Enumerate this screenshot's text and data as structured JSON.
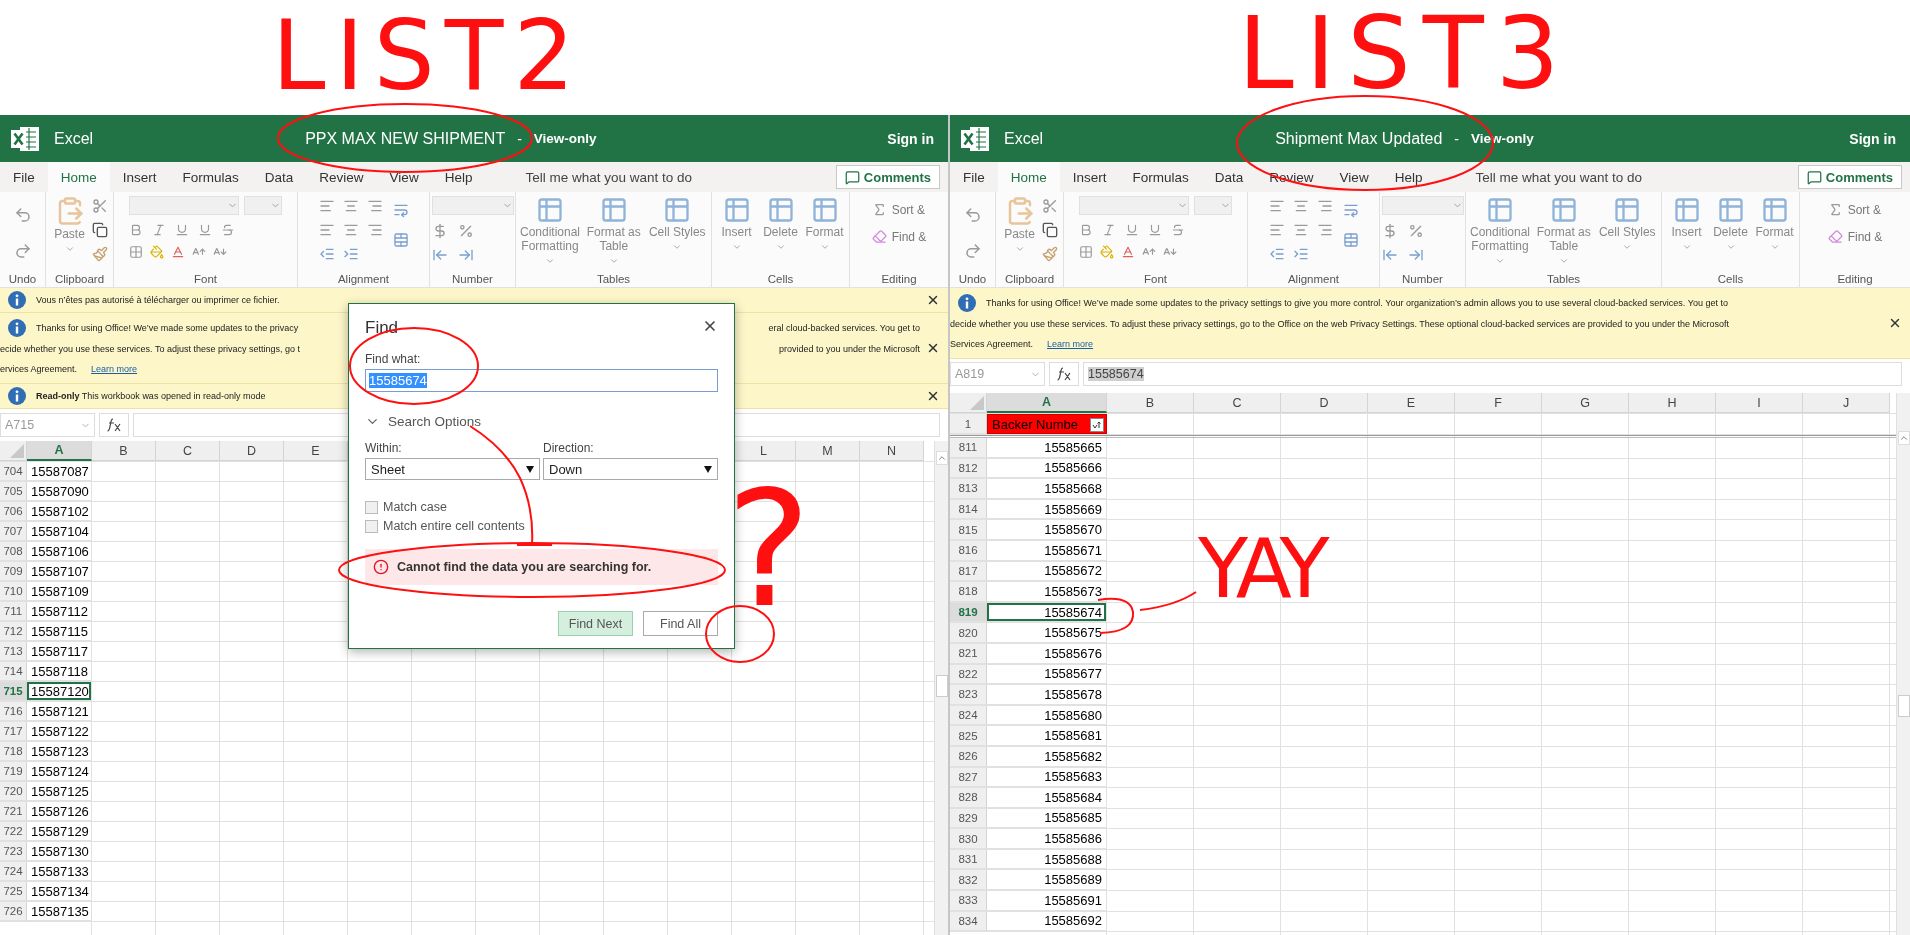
{
  "annotations": {
    "handwriting": [
      {
        "text": "LIST2"
      },
      {
        "text": "LIST3"
      },
      {
        "text": "?"
      },
      {
        "text": "YAY"
      }
    ]
  },
  "panes": [
    {
      "app": "Excel",
      "title": "PPX MAX NEW SHIPMENT",
      "separator": "-",
      "mode": "View-only",
      "sign_in": "Sign in",
      "tabs": [
        {
          "label": "File",
          "selected": false
        },
        {
          "label": "Home",
          "selected": true
        },
        {
          "label": "Insert",
          "selected": false
        },
        {
          "label": "Formulas",
          "selected": false
        },
        {
          "label": "Data",
          "selected": false
        },
        {
          "label": "Review",
          "selected": false
        },
        {
          "label": "View",
          "selected": false
        },
        {
          "label": "Help",
          "selected": false
        }
      ],
      "tell_me": "Tell me what you want to do",
      "comments": "Comments",
      "ribbon": [
        {
          "kind": "undo",
          "label": "Undo"
        },
        {
          "kind": "clipboard",
          "label": "Clipboard",
          "buttons": [
            "Paste"
          ]
        },
        {
          "kind": "font",
          "label": "Font"
        },
        {
          "kind": "alignment",
          "label": "Alignment"
        },
        {
          "kind": "number",
          "label": "Number"
        },
        {
          "kind": "large",
          "label": "Tables",
          "buttons": [
            "Conditional Formatting",
            "Format as Table",
            "Cell Styles"
          ]
        },
        {
          "kind": "large",
          "label": "Cells",
          "buttons": [
            "Insert",
            "Delete",
            "Format"
          ]
        },
        {
          "kind": "editing",
          "label": "Editing",
          "buttons": [
            "Sort &",
            "Find &"
          ]
        }
      ],
      "notifications": [
        {
          "lines": [
            {
              "left": "Vous n’êtes pas autorisé à télécharger ou imprimer ce fichier."
            }
          ]
        },
        {
          "lines": [
            {
              "left": "Thanks for using Office! We’ve made some updates to the privacy",
              "right": "eral cloud-backed services. You get to"
            },
            {
              "left": "ecide whether you use these services. To adjust these privacy settings, go t",
              "right": "provided to you under the Microsoft"
            },
            {
              "left": "ervices Agreement."
            }
          ],
          "link": "Learn more"
        },
        {
          "lines": [
            {
              "left": "**Read-only**   This workbook was opened in read-only mode"
            }
          ]
        }
      ],
      "name_box": "A715",
      "columns": [
        {
          "label": "A",
          "selected": true
        },
        {
          "label": "B",
          "selected": false
        },
        {
          "label": "C",
          "selected": false
        },
        {
          "label": "D",
          "selected": false
        },
        {
          "label": "E",
          "selected": false
        },
        {
          "label": "L",
          "selected": false
        },
        {
          "label": "M",
          "selected": false
        },
        {
          "label": "N",
          "selected": false
        }
      ],
      "rows": [
        {
          "num": "704",
          "value": "15587087",
          "selected": false
        },
        {
          "num": "705",
          "value": "15587090",
          "selected": false
        },
        {
          "num": "706",
          "value": "15587102",
          "selected": false
        },
        {
          "num": "707",
          "value": "15587104",
          "selected": false
        },
        {
          "num": "708",
          "value": "15587106",
          "selected": false
        },
        {
          "num": "709",
          "value": "15587107",
          "selected": false
        },
        {
          "num": "710",
          "value": "15587109",
          "selected": false
        },
        {
          "num": "711",
          "value": "15587112",
          "selected": false
        },
        {
          "num": "712",
          "value": "15587115",
          "selected": false
        },
        {
          "num": "713",
          "value": "15587117",
          "selected": false
        },
        {
          "num": "714",
          "value": "15587118",
          "selected": false
        },
        {
          "num": "715",
          "value": "15587120",
          "selected": true
        },
        {
          "num": "716",
          "value": "15587121",
          "selected": false
        },
        {
          "num": "717",
          "value": "15587122",
          "selected": false
        },
        {
          "num": "718",
          "value": "15587123",
          "selected": false
        },
        {
          "num": "719",
          "value": "15587124",
          "selected": false
        },
        {
          "num": "720",
          "value": "15587125",
          "selected": false
        },
        {
          "num": "721",
          "value": "15587126",
          "selected": false
        },
        {
          "num": "722",
          "value": "15587129",
          "selected": false
        },
        {
          "num": "723",
          "value": "15587130",
          "selected": false
        },
        {
          "num": "724",
          "value": "15587133",
          "selected": false
        },
        {
          "num": "725",
          "value": "15587134",
          "selected": false
        },
        {
          "num": "726",
          "value": "15587135",
          "selected": false
        }
      ],
      "dialog": {
        "title": "Find",
        "find_label": "Find what:",
        "find_value": "15585674",
        "options_label": "Search Options",
        "within_label": "Within:",
        "within": "Sheet",
        "direction_label": "Direction:",
        "direction": "Down",
        "checkboxes": [
          {
            "label": "Match case",
            "checked": false
          },
          {
            "label": "Match entire cell contents",
            "checked": false
          }
        ],
        "error": "Cannot find the data you are searching for.",
        "buttons": [
          {
            "label": "Find Next",
            "primary": true
          },
          {
            "label": "Find All",
            "primary": false
          }
        ]
      }
    },
    {
      "app": "Excel",
      "title": "Shipment Max Updated",
      "separator": "-",
      "mode": "View-only",
      "sign_in": "Sign in",
      "tabs": [
        {
          "label": "File",
          "selected": false
        },
        {
          "label": "Home",
          "selected": true
        },
        {
          "label": "Insert",
          "selected": false
        },
        {
          "label": "Formulas",
          "selected": false
        },
        {
          "label": "Data",
          "selected": false
        },
        {
          "label": "Review",
          "selected": false
        },
        {
          "label": "View",
          "selected": false
        },
        {
          "label": "Help",
          "selected": false
        }
      ],
      "tell_me": "Tell me what you want to do",
      "comments": "Comments",
      "ribbon": [
        {
          "kind": "undo",
          "label": "Undo"
        },
        {
          "kind": "clipboard",
          "label": "Clipboard",
          "buttons": [
            "Paste"
          ]
        },
        {
          "kind": "font",
          "label": "Font"
        },
        {
          "kind": "alignment",
          "label": "Alignment"
        },
        {
          "kind": "number",
          "label": "Number"
        },
        {
          "kind": "large",
          "label": "Tables",
          "buttons": [
            "Conditional Formatting",
            "Format as Table",
            "Cell Styles"
          ]
        },
        {
          "kind": "large",
          "label": "Cells",
          "buttons": [
            "Insert",
            "Delete",
            "Format"
          ]
        },
        {
          "kind": "editing",
          "label": "Editing",
          "buttons": [
            "Sort &",
            "Find &"
          ]
        }
      ],
      "notifications": [
        {
          "lines": [
            {
              "left": "Thanks for using Office! We’ve made some updates to the privacy settings to give you more control. Your organization’s admin allows you to use several cloud-backed services. You get to"
            },
            {
              "left": "decide whether you use these services. To adjust these privacy settings, go to the Office on the web Privacy Settings. These optional cloud-backed services are provided to you under the Microsoft"
            },
            {
              "left": "Services Agreement."
            }
          ],
          "link": "Learn more"
        }
      ],
      "name_box": "A819",
      "formula": "15585674",
      "columns": [
        {
          "label": "A",
          "selected": true
        },
        {
          "label": "B",
          "selected": false
        },
        {
          "label": "C",
          "selected": false
        },
        {
          "label": "D",
          "selected": false
        },
        {
          "label": "E",
          "selected": false
        },
        {
          "label": "F",
          "selected": false
        },
        {
          "label": "G",
          "selected": false
        },
        {
          "label": "H",
          "selected": false
        },
        {
          "label": "I",
          "selected": false
        },
        {
          "label": "J",
          "selected": false
        }
      ],
      "header_row": {
        "num": "1",
        "value": "Backer Numbe"
      },
      "rows": [
        {
          "num": "811",
          "value": "15585665",
          "selected": false
        },
        {
          "num": "812",
          "value": "15585666",
          "selected": false
        },
        {
          "num": "813",
          "value": "15585668",
          "selected": false
        },
        {
          "num": "814",
          "value": "15585669",
          "selected": false
        },
        {
          "num": "815",
          "value": "15585670",
          "selected": false
        },
        {
          "num": "816",
          "value": "15585671",
          "selected": false
        },
        {
          "num": "817",
          "value": "15585672",
          "selected": false
        },
        {
          "num": "818",
          "value": "15585673",
          "selected": false
        },
        {
          "num": "819",
          "value": "15585674",
          "selected": true
        },
        {
          "num": "820",
          "value": "15585675",
          "selected": false
        },
        {
          "num": "821",
          "value": "15585676",
          "selected": false
        },
        {
          "num": "822",
          "value": "15585677",
          "selected": false
        },
        {
          "num": "823",
          "value": "15585678",
          "selected": false
        },
        {
          "num": "824",
          "value": "15585680",
          "selected": false
        },
        {
          "num": "825",
          "value": "15585681",
          "selected": false
        },
        {
          "num": "826",
          "value": "15585682",
          "selected": false
        },
        {
          "num": "827",
          "value": "15585683",
          "selected": false
        },
        {
          "num": "828",
          "value": "15585684",
          "selected": false
        },
        {
          "num": "829",
          "value": "15585685",
          "selected": false
        },
        {
          "num": "830",
          "value": "15585686",
          "selected": false
        },
        {
          "num": "831",
          "value": "15585688",
          "selected": false
        },
        {
          "num": "832",
          "value": "15585689",
          "selected": false
        },
        {
          "num": "833",
          "value": "15585691",
          "selected": false
        },
        {
          "num": "834",
          "value": "15585692",
          "selected": false
        }
      ]
    }
  ]
}
